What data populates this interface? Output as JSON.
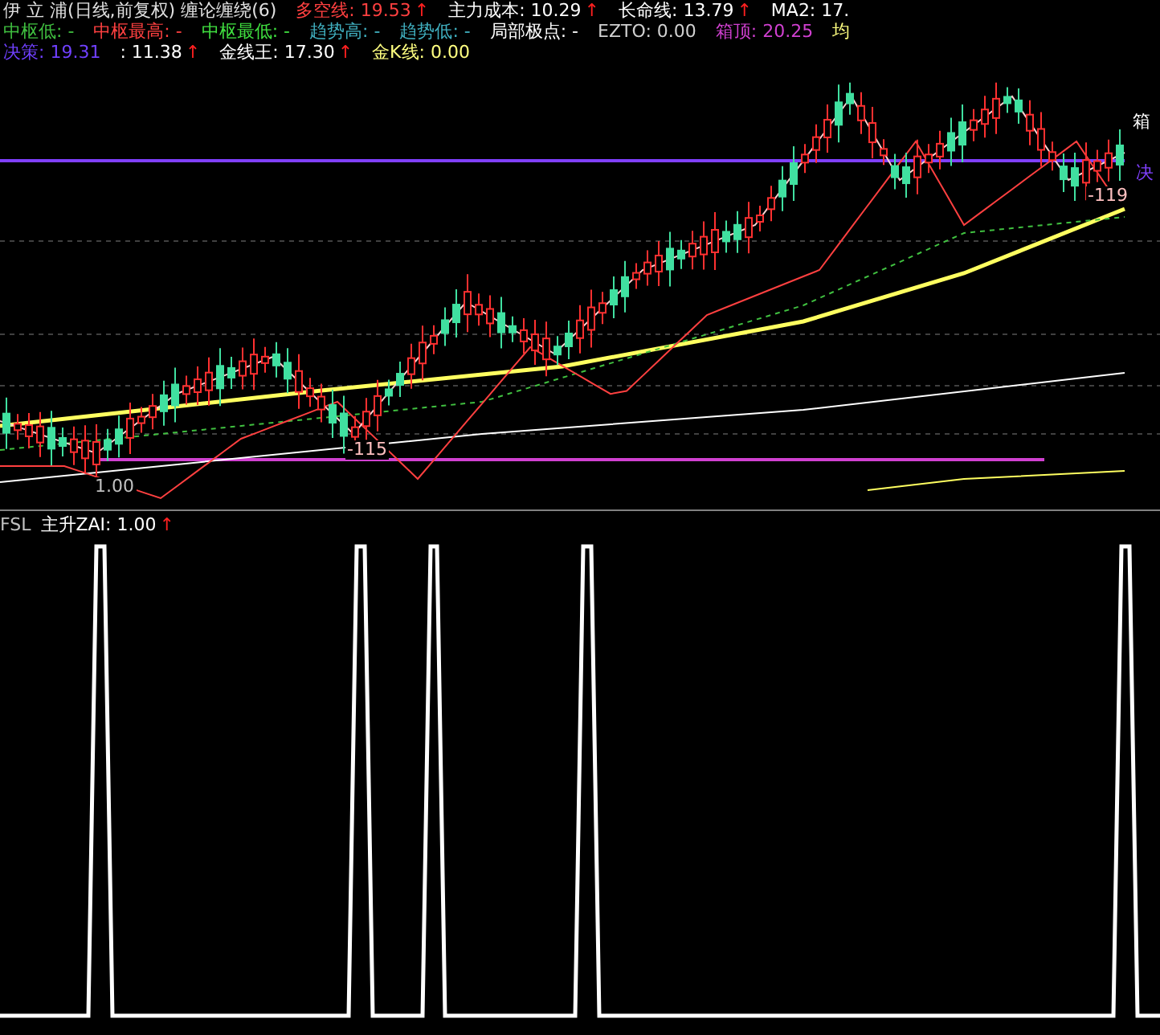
{
  "header": {
    "line_1": [
      {
        "text": "伊 立 浦(日线,前复权) 缠论缠绕(6)",
        "color": "#e0e0e0"
      },
      {
        "text": "多空线: 19.53",
        "color": "#ff4040",
        "mark": "↑"
      },
      {
        "text": "主力成本: 10.29",
        "color": "#ffffff",
        "mark": "↑"
      },
      {
        "text": "长命线: 13.79",
        "color": "#ffffff",
        "mark": "↑"
      },
      {
        "text": "MA2: 17.",
        "color": "#ffffff"
      }
    ],
    "line_2": [
      {
        "text": "中枢低: -",
        "color": "#40c040"
      },
      {
        "text": "中枢最高: -",
        "color": "#ff4040"
      },
      {
        "text": "中枢最低: -",
        "color": "#40e040"
      },
      {
        "text": "趋势高: -",
        "color": "#40b0c0"
      },
      {
        "text": "趋势低: -",
        "color": "#40b0c0"
      },
      {
        "text": "局部极点: -",
        "color": "#ffffff"
      },
      {
        "text": "EZTO: 0.00",
        "color": "#d0d0d0"
      },
      {
        "text": "箱顶: 20.25",
        "color": "#d040d0"
      },
      {
        "text": "均",
        "color": "#ffff80"
      }
    ],
    "line_3": [
      {
        "text": "决策: 19.31",
        "color": "#7040ff"
      },
      {
        "text": ": 11.38",
        "color": "#ffffff",
        "mark": "↑"
      },
      {
        "text": "金线王: 17.30",
        "color": "#ffffff",
        "mark": "↑"
      },
      {
        "text": "金K线: 0.00",
        "color": "#ffff80"
      }
    ]
  },
  "chart_labels": [
    "-115",
    "-119",
    "箱",
    "决",
    "1.00"
  ],
  "indicator": {
    "name": "FSL",
    "label": "主升ZAI: 1.00",
    "mark": "↑"
  }
}
